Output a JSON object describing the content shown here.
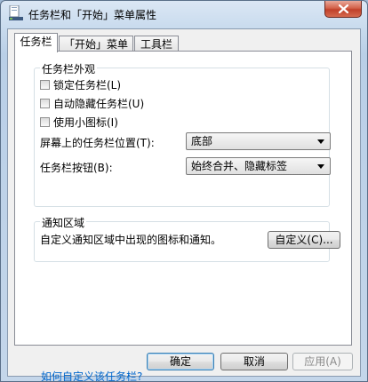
{
  "window": {
    "title": "任务栏和「开始」菜单属性",
    "icons": {
      "app": "taskbar-properties-icon",
      "close": "close-icon"
    }
  },
  "tabs": [
    {
      "label": "任务栏",
      "active": true
    },
    {
      "label": "「开始」菜单",
      "active": false
    },
    {
      "label": "工具栏",
      "active": false
    }
  ],
  "appearance": {
    "title": "任务栏外观",
    "options": [
      {
        "label": "锁定任务栏(L)",
        "checked": false
      },
      {
        "label": "自动隐藏任务栏(U)",
        "checked": false
      },
      {
        "label": "使用小图标(I)",
        "checked": false
      }
    ],
    "location": {
      "label": "屏幕上的任务栏位置(T):",
      "value": "底部"
    },
    "buttons": {
      "label": "任务栏按钮(B):",
      "value": "始终合并、隐藏标签"
    }
  },
  "notification": {
    "title": "通知区域",
    "description": "自定义通知区域中出现的图标和通知。",
    "customize_button": "自定义(C)..."
  },
  "help_link": "如何自定义该任务栏?",
  "footer": {
    "ok": "确定",
    "cancel": "取消",
    "apply": "应用(A)"
  }
}
